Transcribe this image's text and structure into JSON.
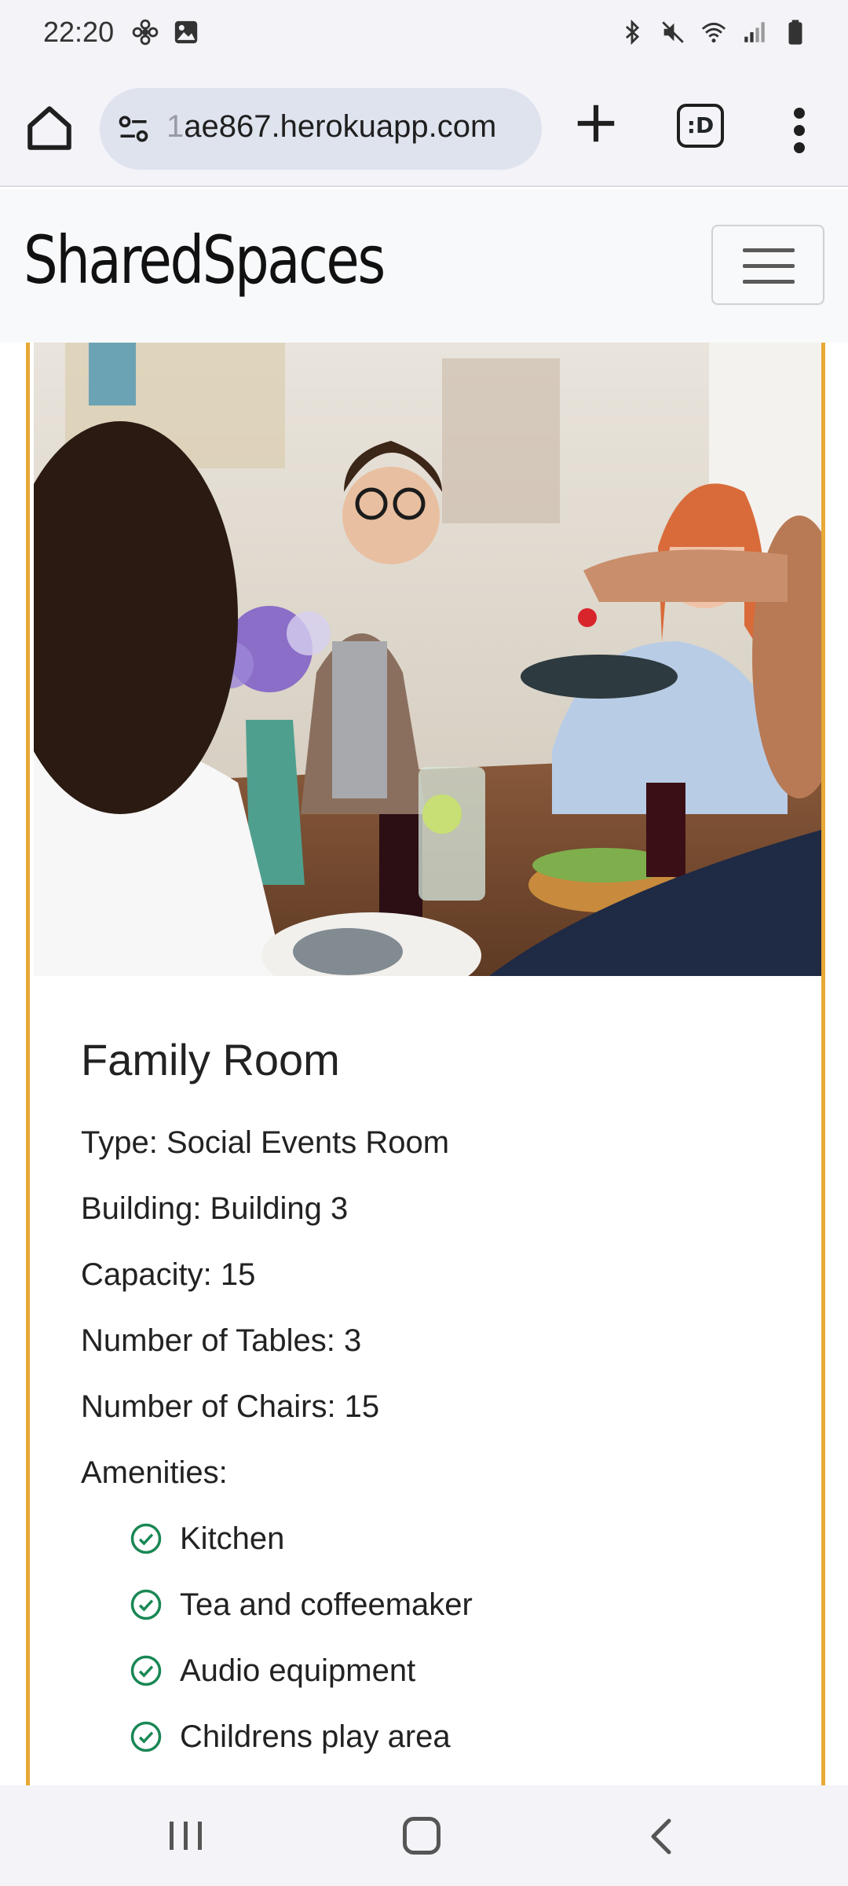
{
  "status_bar": {
    "time": "22:20",
    "left_icons": [
      "flower-icon",
      "image-icon"
    ],
    "right_icons": [
      "bluetooth-icon",
      "mute-icon",
      "wifi-icon",
      "signal-icon",
      "battery-icon"
    ]
  },
  "browser": {
    "url_faded": "1",
    "url": "ae867.herokuapp.com",
    "tabs_label": ":D"
  },
  "site": {
    "brand": "SharedSpaces"
  },
  "room": {
    "title": "Family Room",
    "details": [
      "Type: Social Events Room",
      "Building: Building 3",
      "Capacity: 15",
      "Number of Tables: 3",
      "Number of Chairs: 15",
      "Amenities:"
    ],
    "amenities": [
      "Kitchen",
      "Tea and coffeemaker",
      "Audio equipment",
      "Childrens play area"
    ]
  },
  "colors": {
    "card_border": "#e8a936",
    "check": "#198754"
  }
}
